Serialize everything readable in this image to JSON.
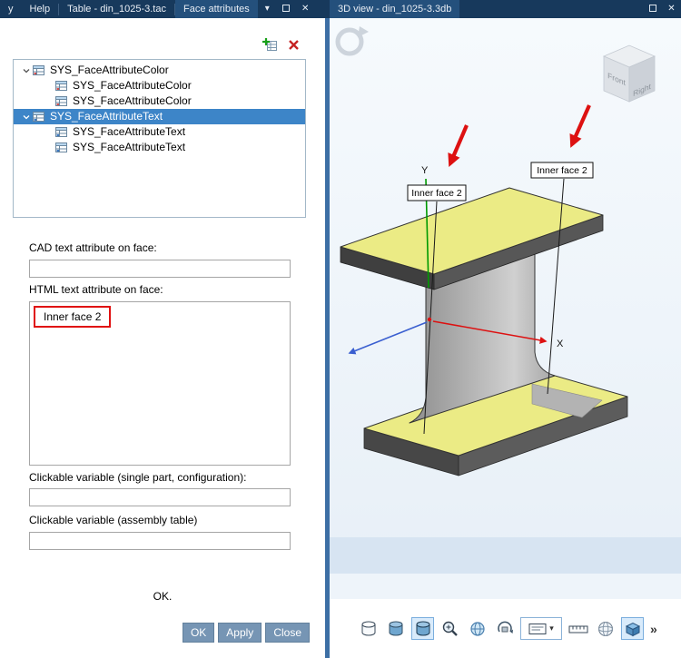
{
  "title_bar": {
    "menu_partial": "y",
    "help": "Help",
    "table_tab": "Table - din_1025-3.tac",
    "face_tab": "Face attributes",
    "caret": "▾",
    "close": "✕",
    "view_tab": "3D view - din_1025-3.3db",
    "view_close": "✕"
  },
  "attributes_panel": {
    "tree": {
      "rows": [
        {
          "label": "SYS_FaceAttributeColor"
        },
        {
          "label": "SYS_FaceAttributeColor"
        },
        {
          "label": "SYS_FaceAttributeColor"
        },
        {
          "label": "SYS_FaceAttributeText"
        },
        {
          "label": "SYS_FaceAttributeText"
        },
        {
          "label": "SYS_FaceAttributeText"
        }
      ]
    },
    "cad_text_label": "CAD text attribute on face:",
    "cad_text_value": "",
    "html_text_label": "HTML text attribute on face:",
    "html_text_value": "Inner face 2",
    "clickable_single_label": "Clickable variable (single part, configuration):",
    "clickable_single_value": "",
    "clickable_assembly_label": "Clickable variable (assembly table)",
    "clickable_assembly_value": "",
    "status_text": "OK.",
    "ok_button": "OK",
    "apply_button": "Apply",
    "close_button": "Close"
  },
  "viewport": {
    "face_label_left": "Inner face 2",
    "face_label_right": "Inner face 2",
    "axis_x_label": "X",
    "axis_y_label": "Y",
    "view_cube": {
      "front": "Front",
      "right": "Right"
    },
    "toolbar_overflow": "»"
  },
  "colors": {
    "titlebar": "#17395c",
    "active_tab": "#24507c",
    "tree_selection": "#3d85c8",
    "button": "#7695b4",
    "annotation_red": "#dd1111",
    "face_yellow": "#ebeb85",
    "splitter_blue": "#3d6fa5"
  }
}
